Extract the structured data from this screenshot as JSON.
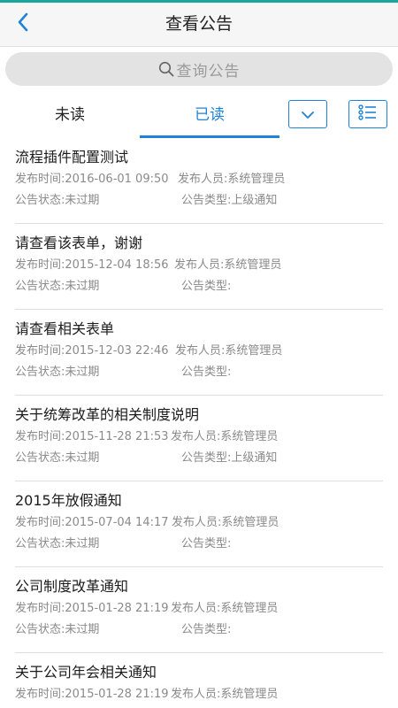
{
  "colors": {
    "accent": "#1f83d9",
    "top_strip": "#1aa79b",
    "header_bg": "#f6f6f6",
    "search_bg": "#e3e3e3"
  },
  "header": {
    "title": "查看公告",
    "back_icon": "chevron-left-icon"
  },
  "search": {
    "placeholder": "查询公告",
    "icon": "search-icon"
  },
  "tabs": [
    {
      "label": "未读",
      "active": false
    },
    {
      "label": "已读",
      "active": true
    }
  ],
  "toolbar": {
    "dropdown_icon": "chevron-down-icon",
    "list_icon": "list-icon"
  },
  "announcements": [
    {
      "title": "流程插件配置测试",
      "time": "发布时间:2016-06-01 09:50",
      "publisher": "发布人员:系统管理员",
      "status": "公告状态:未过期",
      "type": "公告类型:上级通知"
    },
    {
      "title": "请查看该表单，谢谢",
      "time": "发布时间:2015-12-04 18:56",
      "publisher": "发布人员:系统管理员",
      "status": "公告状态:未过期",
      "type": "公告类型:"
    },
    {
      "title": "请查看相关表单",
      "time": "发布时间:2015-12-03 22:46",
      "publisher": "发布人员:系统管理员",
      "status": "公告状态:未过期",
      "type": "公告类型:"
    },
    {
      "title": "关于统筹改革的相关制度说明",
      "time": "发布时间:2015-11-28 21:53",
      "publisher": "发布人员:系统管理员",
      "status": "公告状态:未过期",
      "type": "公告类型:上级通知"
    },
    {
      "title": "2015年放假通知",
      "time": "发布时间:2015-07-04 14:17",
      "publisher": "发布人员:系统管理员",
      "status": "公告状态:未过期",
      "type": "公告类型:"
    },
    {
      "title": "公司制度改革通知",
      "time": "发布时间:2015-01-28 21:19",
      "publisher": "发布人员:系统管理员",
      "status": "公告状态:未过期",
      "type": "公告类型:"
    },
    {
      "title": "关于公司年会相关通知",
      "time": "发布时间:2015-01-28 21:19",
      "publisher": "发布人员:系统管理员",
      "status": "",
      "type": ""
    }
  ]
}
